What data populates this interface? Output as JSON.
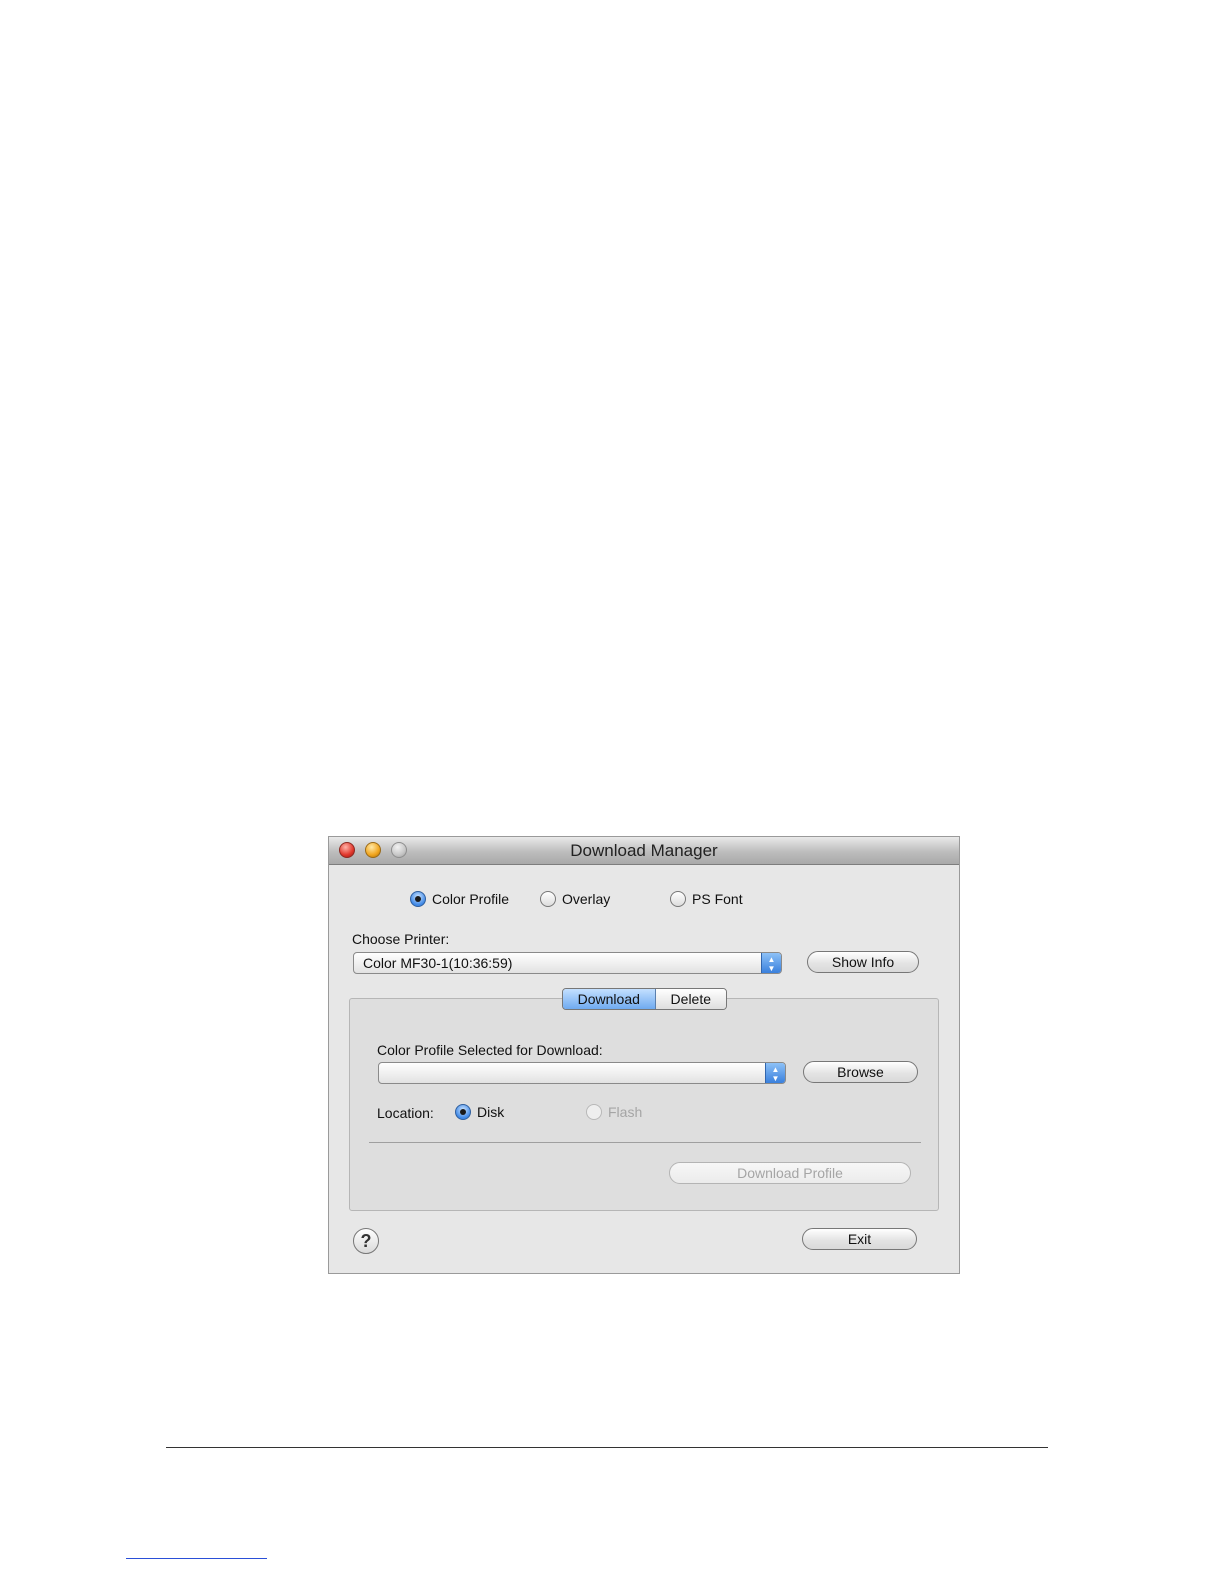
{
  "window": {
    "title": "Download Manager"
  },
  "download_type": {
    "options": [
      {
        "label": "Color Profile",
        "selected": true
      },
      {
        "label": "Overlay",
        "selected": false
      },
      {
        "label": "PS Font",
        "selected": false
      }
    ]
  },
  "printer": {
    "label": "Choose Printer:",
    "selected": "Color MF30-1(10:36:59)",
    "show_info_label": "Show Info"
  },
  "tabs": {
    "download": "Download",
    "delete": "Delete",
    "active": "Download"
  },
  "download_panel": {
    "file_label": "Color Profile Selected for Download:",
    "file_value": "",
    "browse_label": "Browse",
    "location_label": "Location:",
    "location_disk": "Disk",
    "location_flash": "Flash",
    "location_selected": "Disk",
    "download_button": "Download Profile"
  },
  "footer": {
    "help_symbol": "?",
    "exit_label": "Exit"
  },
  "colors": {
    "accent": "#3a80dd",
    "window_bg": "#e7e7e7"
  }
}
